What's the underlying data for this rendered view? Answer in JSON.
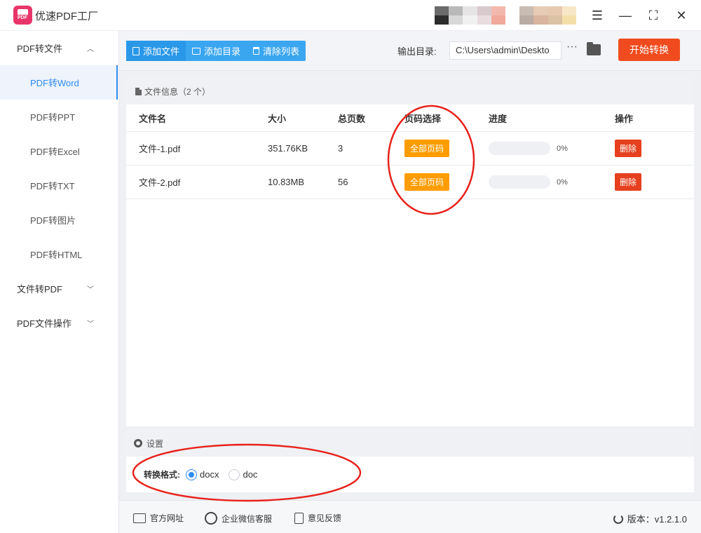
{
  "app": {
    "title": "优速PDF工厂"
  },
  "window": {
    "menu_icon": "☰",
    "minimize_icon": "—",
    "maximize_icon": "⛶",
    "close_icon": "✕"
  },
  "sidebar": {
    "groups": [
      {
        "label": "PDF转文件",
        "chevron": "︿"
      },
      {
        "label": "文件转PDF",
        "chevron": "﹀"
      },
      {
        "label": "PDF文件操作",
        "chevron": "﹀"
      }
    ],
    "items": [
      {
        "label": "PDF转Word"
      },
      {
        "label": "PDF转PPT"
      },
      {
        "label": "PDF转Excel"
      },
      {
        "label": "PDF转TXT"
      },
      {
        "label": "PDF转图片"
      },
      {
        "label": "PDF转HTML"
      }
    ]
  },
  "toolbar": {
    "add_file": "添加文件",
    "add_folder": "添加目录",
    "clear_list": "清除列表",
    "output_label": "输出目录:",
    "output_path": "C:\\Users\\admin\\Deskto",
    "more": "···",
    "start": "开始转换"
  },
  "file_panel": {
    "header": "文件信息（2 个）",
    "columns": [
      "文件名",
      "大小",
      "总页数",
      "页码选择",
      "进度",
      "操作"
    ],
    "rows": [
      {
        "name": "文件-1.pdf",
        "size": "351.76KB",
        "pages": "3",
        "range": "全部页码",
        "progress": 0,
        "progress_text": "0%",
        "action": "删除"
      },
      {
        "name": "文件-2.pdf",
        "size": "10.83MB",
        "pages": "56",
        "range": "全部页码",
        "progress": 0,
        "progress_text": "0%",
        "action": "删除"
      }
    ]
  },
  "settings": {
    "header": "设置",
    "format_label": "转换格式:",
    "options": [
      {
        "label": "docx",
        "selected": true
      },
      {
        "label": "doc",
        "selected": false
      }
    ]
  },
  "footer": {
    "website": "官方网址",
    "wechat": "企业微信客服",
    "feedback": "意见反馈",
    "version": "版本：v1.2.1.0"
  },
  "colors": {
    "accent": "#2d8cf0",
    "toolbar_button": "#3aa6f0",
    "start_button": "#f04b1e",
    "page_badge": "#ff9c00",
    "delete_button": "#e6401f",
    "annotation": "#e8221b"
  },
  "mosaic_colors": [
    "#6b6b6b",
    "#b9b9b9",
    "#e7e4e6",
    "#d8c9cd",
    "#f3b8ad",
    "#ffffff",
    "#c9bcb2",
    "#e6cbb5",
    "#e7c9b0",
    "#f7e7c6",
    "#2c2c2c",
    "#d7d7d7",
    "#f1f1f1",
    "#e9dde0",
    "#f0a99a",
    "#ffffff",
    "#b9aca4",
    "#d9b49e",
    "#dcc2a4",
    "#f4dfa8"
  ]
}
